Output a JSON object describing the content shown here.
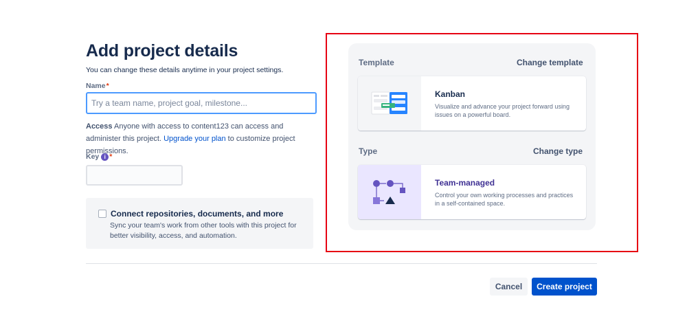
{
  "header": {
    "title": "Add project details",
    "subtitle": "You can change these details anytime in your project settings."
  },
  "form": {
    "name_label": "Name",
    "required_marker": "*",
    "name_placeholder": "Try a team name, project goal, milestone...",
    "access": {
      "label": "Access",
      "text_before": " Anyone with access to content123 can access and administer this project. ",
      "link": "Upgrade your plan",
      "text_after": " to customize project permissions."
    },
    "key_label": "Key",
    "key_info_icon": "i",
    "connect": {
      "title": "Connect repositories, documents, and more",
      "description": "Sync your team's work from other tools with this project for better visibility, access, and automation."
    }
  },
  "right_panel": {
    "template_label": "Template",
    "change_template": "Change template",
    "template": {
      "name": "Kanban",
      "description": "Visualize and advance your project forward using issues on a powerful board."
    },
    "type_label": "Type",
    "change_type": "Change type",
    "type": {
      "name": "Team-managed",
      "description": "Control your own working processes and practices in a self-contained space."
    }
  },
  "footer": {
    "cancel": "Cancel",
    "create": "Create project"
  },
  "colors": {
    "primary": "#0052cc",
    "team_title": "#403294",
    "team_thumb_bg": "#eae6ff",
    "highlight": "#e60012",
    "required": "#de350b"
  },
  "icons": {
    "kanban_thumb": "kanban-board-illustration",
    "team_thumb": "team-managed-illustration",
    "info": "info-icon",
    "checkbox": "checkbox-unchecked"
  }
}
